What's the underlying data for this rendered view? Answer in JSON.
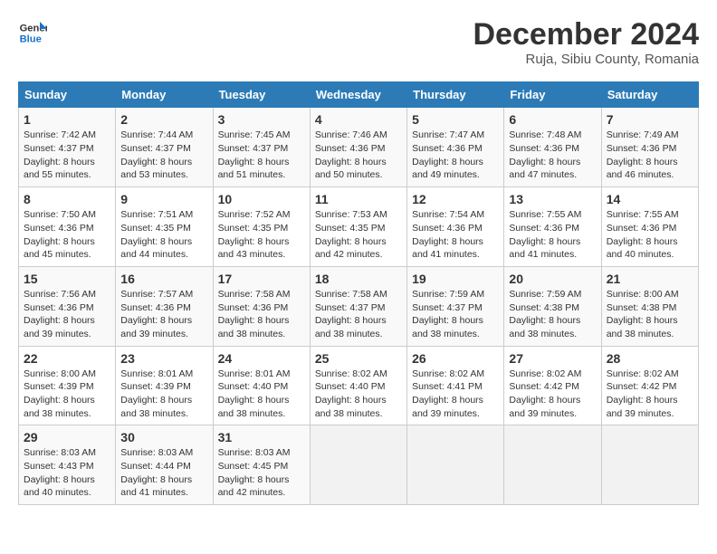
{
  "logo": {
    "line1": "General",
    "line2": "Blue"
  },
  "title": "December 2024",
  "subtitle": "Ruja, Sibiu County, Romania",
  "headers": [
    "Sunday",
    "Monday",
    "Tuesday",
    "Wednesday",
    "Thursday",
    "Friday",
    "Saturday"
  ],
  "weeks": [
    [
      {
        "day": "1",
        "info": "Sunrise: 7:42 AM\nSunset: 4:37 PM\nDaylight: 8 hours and 55 minutes."
      },
      {
        "day": "2",
        "info": "Sunrise: 7:44 AM\nSunset: 4:37 PM\nDaylight: 8 hours and 53 minutes."
      },
      {
        "day": "3",
        "info": "Sunrise: 7:45 AM\nSunset: 4:37 PM\nDaylight: 8 hours and 51 minutes."
      },
      {
        "day": "4",
        "info": "Sunrise: 7:46 AM\nSunset: 4:36 PM\nDaylight: 8 hours and 50 minutes."
      },
      {
        "day": "5",
        "info": "Sunrise: 7:47 AM\nSunset: 4:36 PM\nDaylight: 8 hours and 49 minutes."
      },
      {
        "day": "6",
        "info": "Sunrise: 7:48 AM\nSunset: 4:36 PM\nDaylight: 8 hours and 47 minutes."
      },
      {
        "day": "7",
        "info": "Sunrise: 7:49 AM\nSunset: 4:36 PM\nDaylight: 8 hours and 46 minutes."
      }
    ],
    [
      {
        "day": "8",
        "info": "Sunrise: 7:50 AM\nSunset: 4:36 PM\nDaylight: 8 hours and 45 minutes."
      },
      {
        "day": "9",
        "info": "Sunrise: 7:51 AM\nSunset: 4:35 PM\nDaylight: 8 hours and 44 minutes."
      },
      {
        "day": "10",
        "info": "Sunrise: 7:52 AM\nSunset: 4:35 PM\nDaylight: 8 hours and 43 minutes."
      },
      {
        "day": "11",
        "info": "Sunrise: 7:53 AM\nSunset: 4:35 PM\nDaylight: 8 hours and 42 minutes."
      },
      {
        "day": "12",
        "info": "Sunrise: 7:54 AM\nSunset: 4:36 PM\nDaylight: 8 hours and 41 minutes."
      },
      {
        "day": "13",
        "info": "Sunrise: 7:55 AM\nSunset: 4:36 PM\nDaylight: 8 hours and 41 minutes."
      },
      {
        "day": "14",
        "info": "Sunrise: 7:55 AM\nSunset: 4:36 PM\nDaylight: 8 hours and 40 minutes."
      }
    ],
    [
      {
        "day": "15",
        "info": "Sunrise: 7:56 AM\nSunset: 4:36 PM\nDaylight: 8 hours and 39 minutes."
      },
      {
        "day": "16",
        "info": "Sunrise: 7:57 AM\nSunset: 4:36 PM\nDaylight: 8 hours and 39 minutes."
      },
      {
        "day": "17",
        "info": "Sunrise: 7:58 AM\nSunset: 4:36 PM\nDaylight: 8 hours and 38 minutes."
      },
      {
        "day": "18",
        "info": "Sunrise: 7:58 AM\nSunset: 4:37 PM\nDaylight: 8 hours and 38 minutes."
      },
      {
        "day": "19",
        "info": "Sunrise: 7:59 AM\nSunset: 4:37 PM\nDaylight: 8 hours and 38 minutes."
      },
      {
        "day": "20",
        "info": "Sunrise: 7:59 AM\nSunset: 4:38 PM\nDaylight: 8 hours and 38 minutes."
      },
      {
        "day": "21",
        "info": "Sunrise: 8:00 AM\nSunset: 4:38 PM\nDaylight: 8 hours and 38 minutes."
      }
    ],
    [
      {
        "day": "22",
        "info": "Sunrise: 8:00 AM\nSunset: 4:39 PM\nDaylight: 8 hours and 38 minutes."
      },
      {
        "day": "23",
        "info": "Sunrise: 8:01 AM\nSunset: 4:39 PM\nDaylight: 8 hours and 38 minutes."
      },
      {
        "day": "24",
        "info": "Sunrise: 8:01 AM\nSunset: 4:40 PM\nDaylight: 8 hours and 38 minutes."
      },
      {
        "day": "25",
        "info": "Sunrise: 8:02 AM\nSunset: 4:40 PM\nDaylight: 8 hours and 38 minutes."
      },
      {
        "day": "26",
        "info": "Sunrise: 8:02 AM\nSunset: 4:41 PM\nDaylight: 8 hours and 39 minutes."
      },
      {
        "day": "27",
        "info": "Sunrise: 8:02 AM\nSunset: 4:42 PM\nDaylight: 8 hours and 39 minutes."
      },
      {
        "day": "28",
        "info": "Sunrise: 8:02 AM\nSunset: 4:42 PM\nDaylight: 8 hours and 39 minutes."
      }
    ],
    [
      {
        "day": "29",
        "info": "Sunrise: 8:03 AM\nSunset: 4:43 PM\nDaylight: 8 hours and 40 minutes."
      },
      {
        "day": "30",
        "info": "Sunrise: 8:03 AM\nSunset: 4:44 PM\nDaylight: 8 hours and 41 minutes."
      },
      {
        "day": "31",
        "info": "Sunrise: 8:03 AM\nSunset: 4:45 PM\nDaylight: 8 hours and 42 minutes."
      },
      null,
      null,
      null,
      null
    ]
  ]
}
